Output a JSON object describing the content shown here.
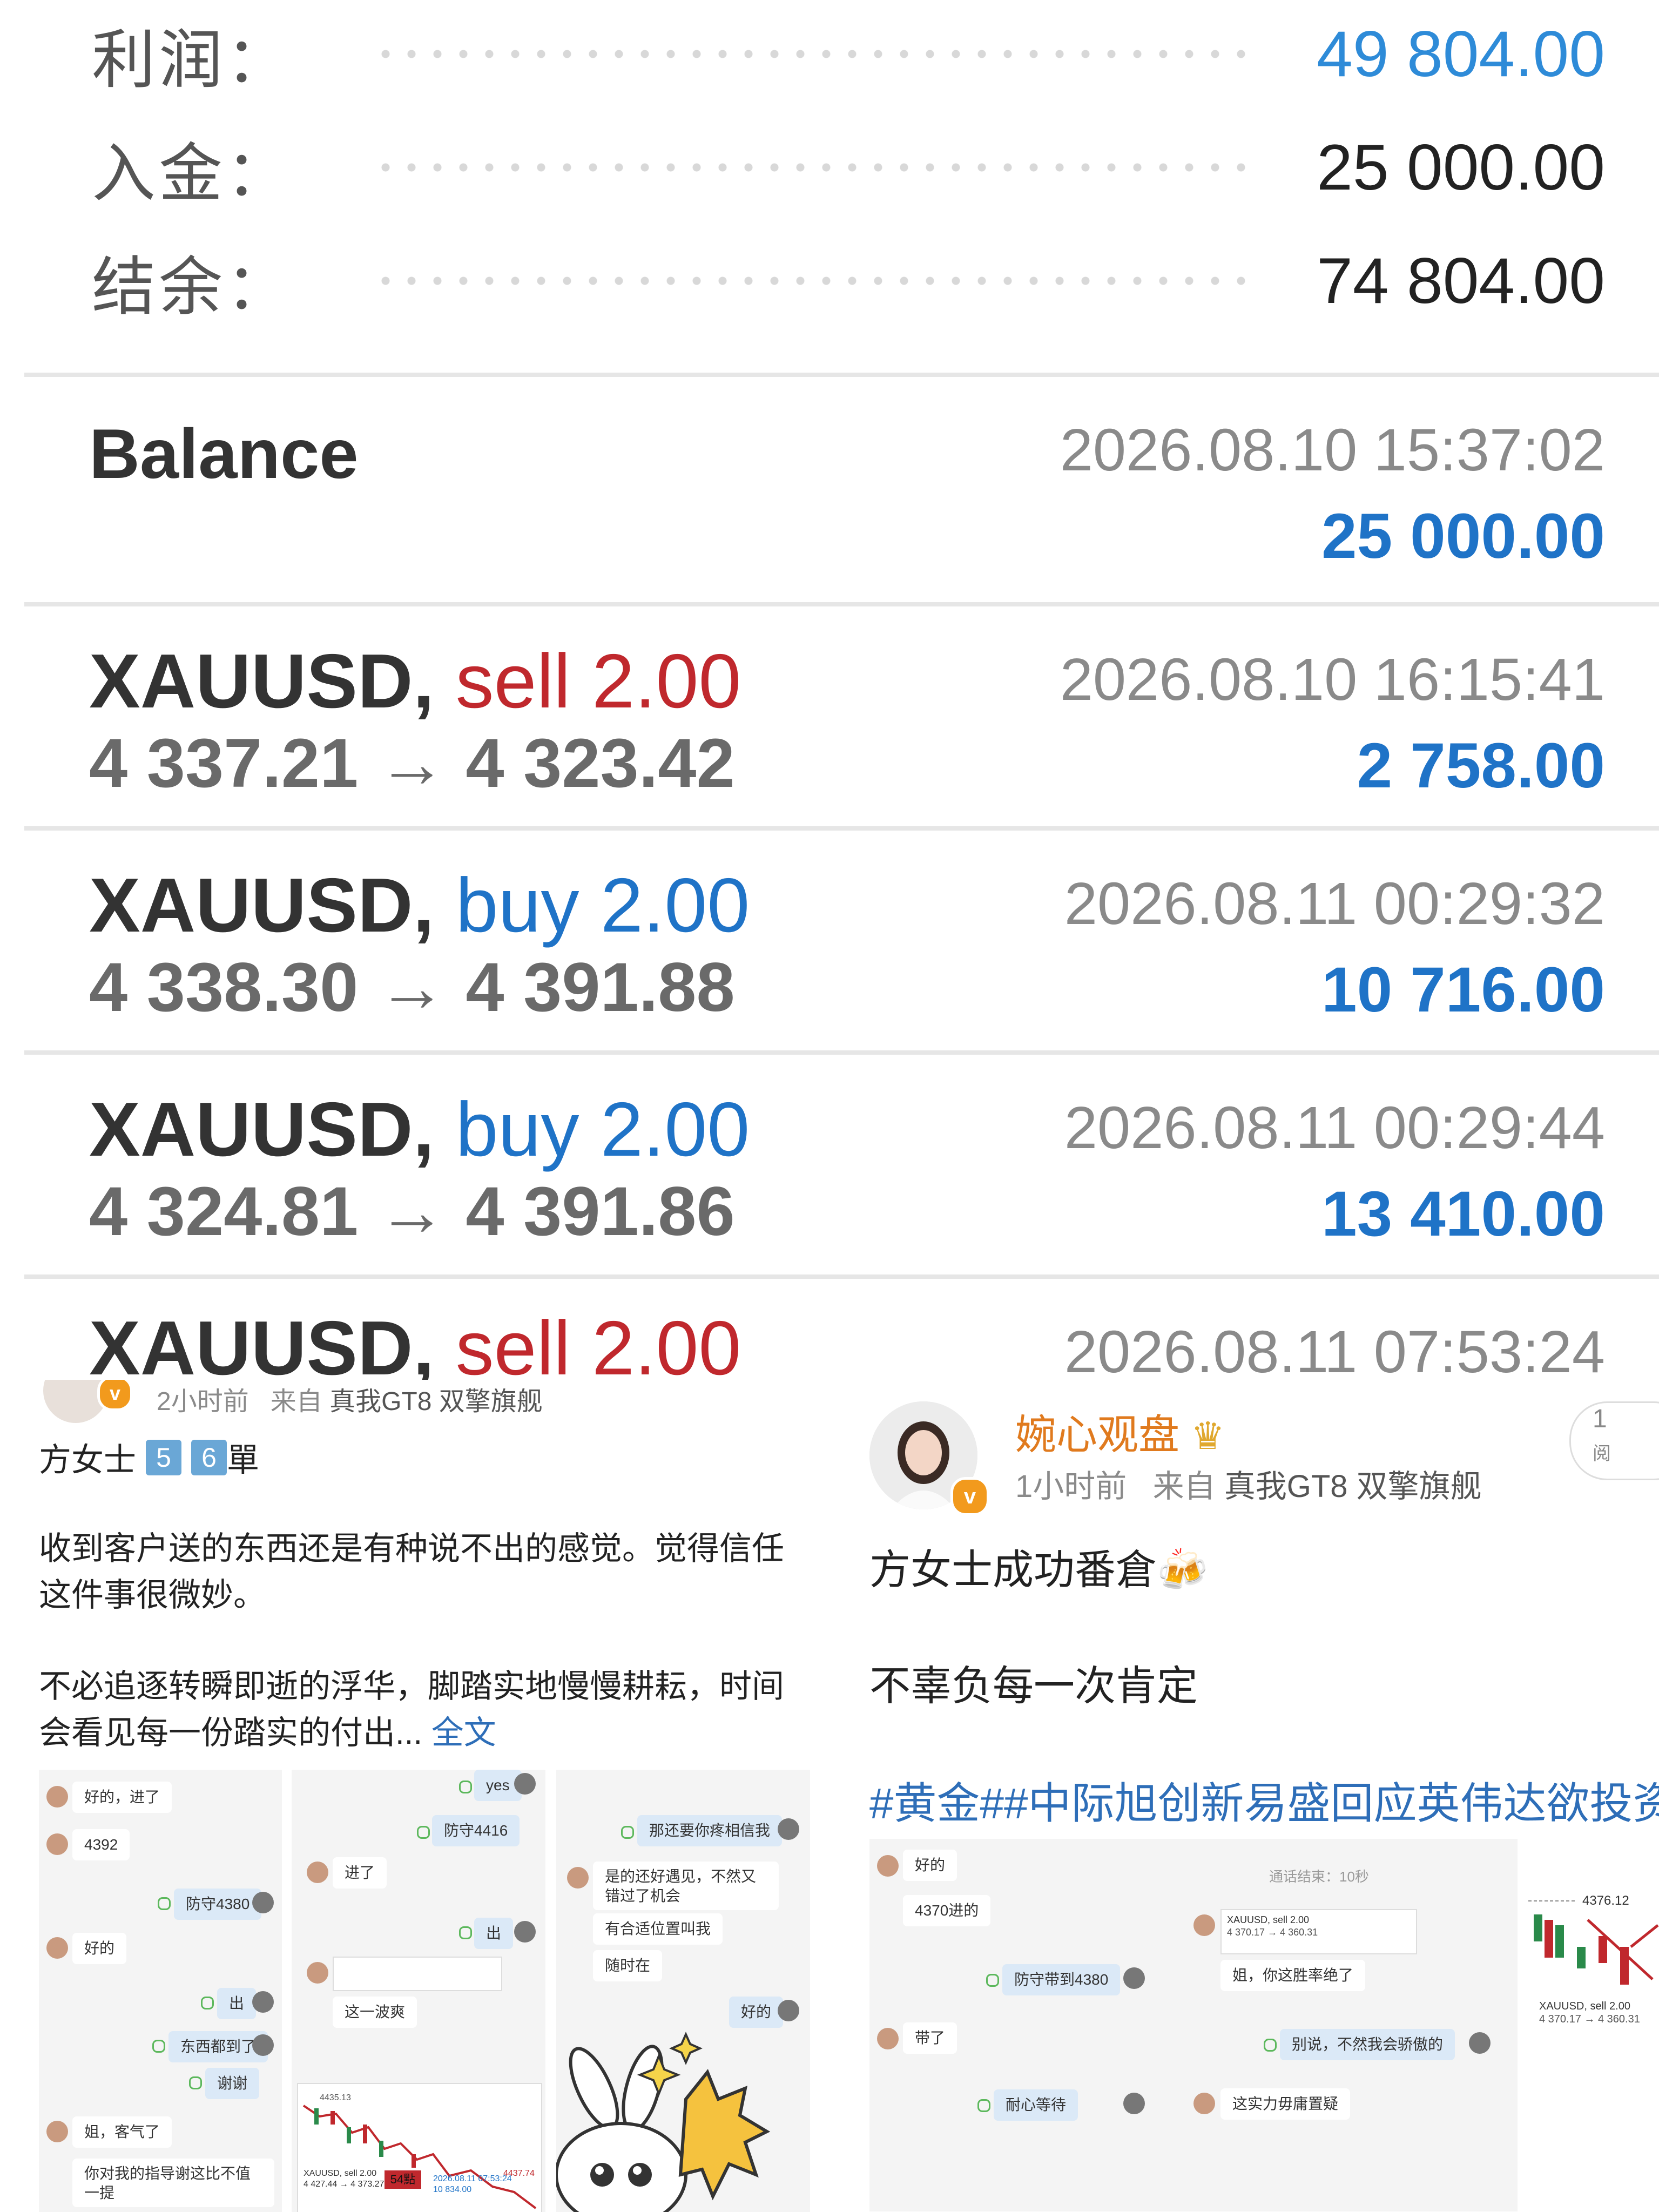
{
  "summary": {
    "profit_label": "利润：",
    "profit_value": "49 804.00",
    "deposit_label": "入金：",
    "deposit_value": "25 000.00",
    "balance_label": "结余：",
    "balance_value": "74 804.00"
  },
  "balance_entry": {
    "title": "Balance",
    "time": "2026.08.10 15:37:02",
    "amount": "25 000.00"
  },
  "deals": [
    {
      "symbol": "XAUUSD",
      "side": "sell 2.00",
      "prices": "4 337.21 → 4 323.42",
      "time": "2026.08.10 16:15:41",
      "profit": "2 758.00"
    },
    {
      "symbol": "XAUUSD",
      "side": "buy 2.00",
      "prices": "4 338.30 → 4 391.88",
      "time": "2026.08.11 00:29:32",
      "profit": "10 716.00"
    },
    {
      "symbol": "XAUUSD",
      "side": "buy 2.00",
      "prices": "4 324.81 → 4 391.86",
      "time": "2026.08.11 00:29:44",
      "profit": "13 410.00"
    },
    {
      "symbol": "XAUUSD",
      "side": "sell 2.00",
      "time": "2026.08.11 07:53:24"
    }
  ],
  "post_left": {
    "time_ago": "2小时前",
    "from_label": "来自",
    "device": "真我GT8 双擎旗舰",
    "title_prefix": "方女士",
    "keycap_5": "5",
    "keycap_6": "6",
    "title_suffix": "單",
    "para1": "收到客户送的东西还是有种说不出的感觉。觉得信任这件事很微妙。",
    "para2": "不必追逐转瞬即逝的浮华，脚踏实地慢慢耕耘，时间会看见每一份踏实的付出...",
    "more": "全文",
    "chat1": {
      "m1": "好的，进了",
      "m2": "4392",
      "m3": "防守4380",
      "m4": "好的",
      "m5": "出",
      "m6": "东西都到了",
      "m7": "谢谢",
      "m8": "姐，客气了",
      "m9": "你对我的指导谢这比不值一提"
    },
    "chat2": {
      "m1": "yes",
      "m2": "防守4416",
      "m3": "进了",
      "m4": "出",
      "m5": "这一波爽",
      "chart_high": "4435.13",
      "chart_label": "XAUUSD, sell 2.00",
      "chart_prices": "4 427.44 → 4 373.27",
      "chart_tag": "54點",
      "chart_profit": "10 834.00",
      "chart_time": "2026.08.11 07:53:24",
      "chart_right_price": "4437.74"
    },
    "chat3": {
      "m1": "那还要你疼相信我",
      "m2": "是的还好遇见，不然又错过了机会",
      "m3": "有合适位置叫我",
      "m4": "随时在",
      "m5": "好的"
    }
  },
  "post_right": {
    "name": "婉心观盘",
    "time_ago": "1小时前",
    "from_label": "来自",
    "device": "真我GT8 双擎旗舰",
    "line1": "方女士成功番倉🍻",
    "line2": "不辜负每一次肯定",
    "hashtags": "#黄金##中际旭创新易盛回应英伟达欲投资",
    "chat": {
      "m1": "好的",
      "m2": "4370进的",
      "m3": "防守带到4380",
      "m4": "带了",
      "m5": "耐心等待",
      "m6": "姐，你这胜率绝了",
      "m7": "别说，不然我会骄傲的",
      "m8": "这实力毋庸置疑",
      "call_end": "通话结束：10秒",
      "deal_label": "XAUUSD, sell 2.00",
      "deal_prices": "4 370.17 → 4 360.31"
    },
    "chart": {
      "price_tag": "4376.12",
      "label": "XAUUSD, sell 2.00",
      "prices": "4 370.17 → 4 360.31"
    },
    "follow_hint": "1",
    "follow_hint2": "阅"
  },
  "colors": {
    "blue": "#1f73c7",
    "red": "#c0282d",
    "orange": "#e07a1e",
    "link": "#2e6eb8"
  }
}
